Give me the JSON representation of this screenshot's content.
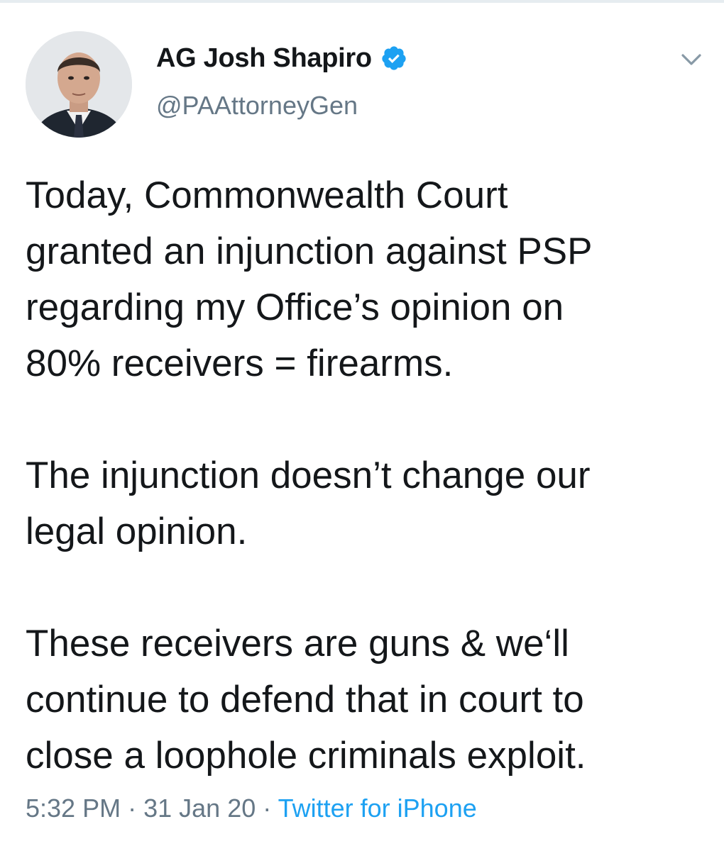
{
  "author": {
    "display_name": "AG Josh Shapiro",
    "handle": "@PAAttorneyGen",
    "verified": true,
    "avatar_icon": "profile-photo"
  },
  "tweet": {
    "paragraphs": [
      [
        "Today, Commonwealth Court",
        "granted an injunction against PSP",
        "regarding my Office’s opinion on",
        "80% receivers = firearms."
      ],
      [
        "The injunction doesn’t change our",
        "legal opinion."
      ],
      [
        "These receivers are guns & we‘ll",
        "continue to defend that in court to",
        "close a loophole criminals exploit."
      ]
    ]
  },
  "meta": {
    "time": "5:32 PM",
    "date": "31 Jan 20",
    "separator": "·",
    "source": "Twitter for iPhone"
  },
  "icons": {
    "verified": "verified-badge-icon",
    "menu": "chevron-down-icon"
  },
  "colors": {
    "text": "#14171a",
    "secondary": "#657786",
    "link": "#1da1f2",
    "verified": "#1da1f2"
  }
}
